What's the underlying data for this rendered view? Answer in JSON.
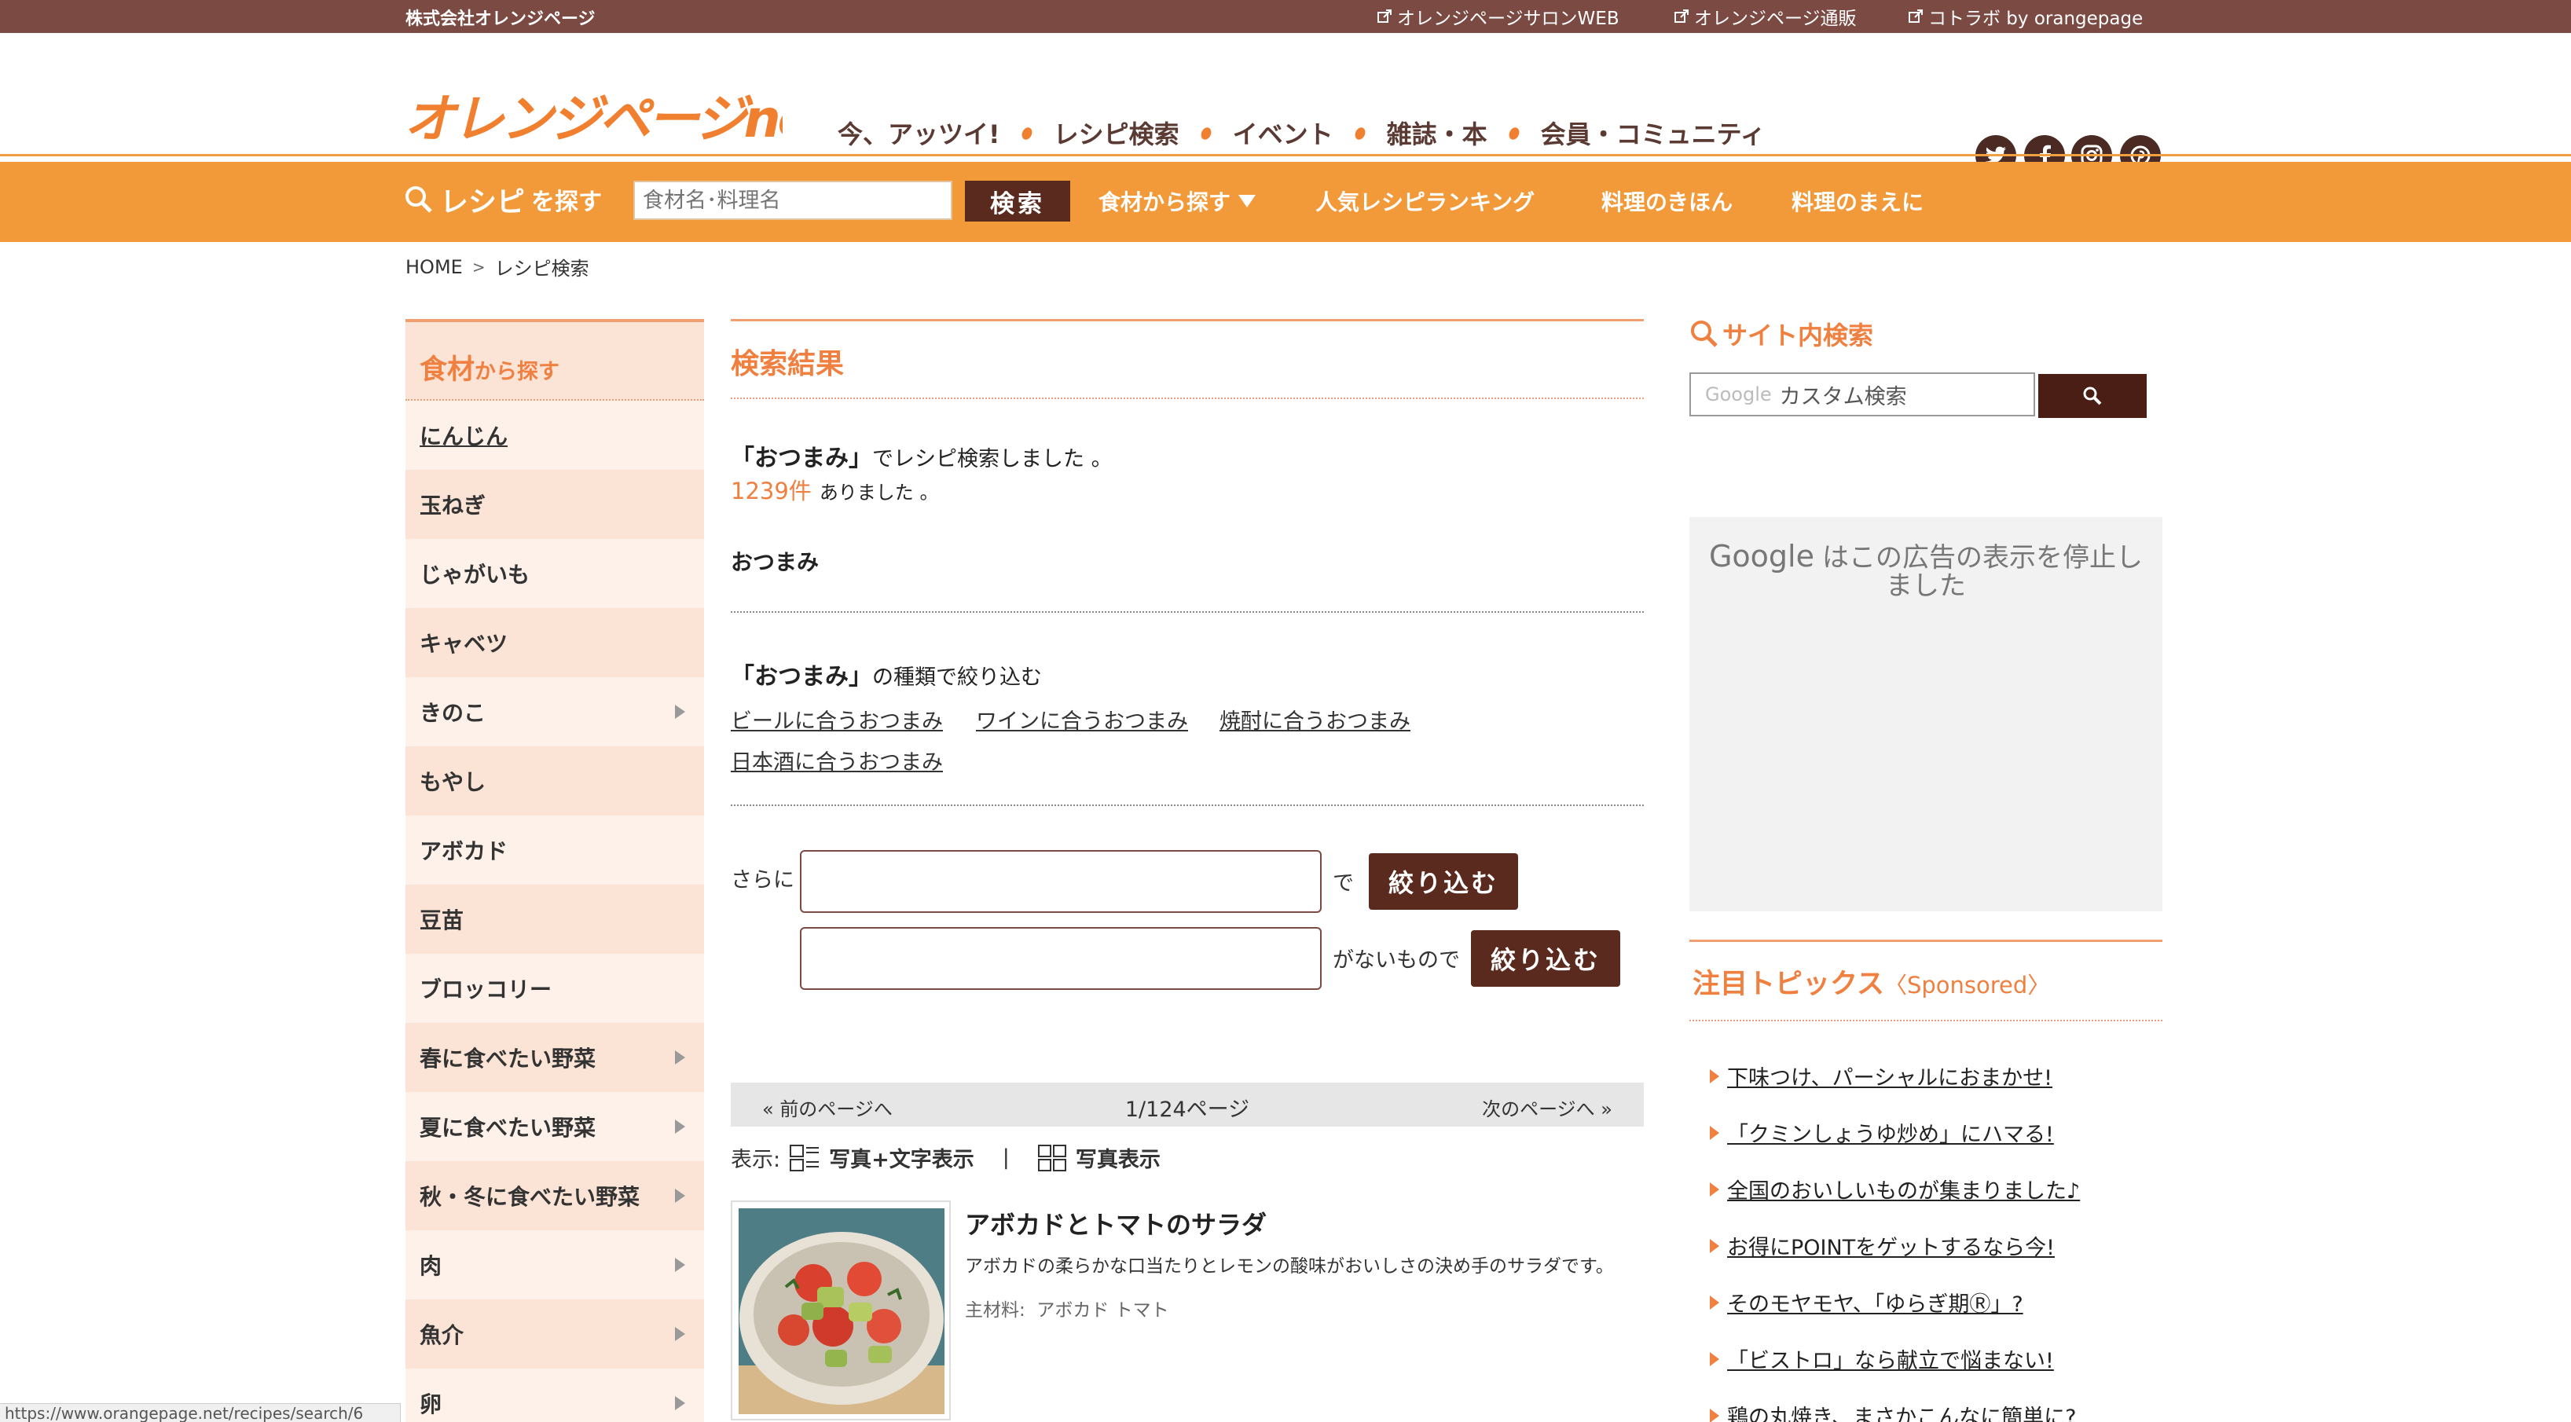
{
  "topbar": {
    "company": "株式会社オレンジページ",
    "links": [
      "オレンジページサロンWEB",
      "オレンジページ通販",
      "コトラボ by orangepage"
    ]
  },
  "header": {
    "logo_text": "オレンジページnet",
    "nav": [
      "今、アッツイ!",
      "レシピ検索",
      "イベント",
      "雑誌・本",
      "会員・コミュニティ"
    ],
    "social": [
      "twitter-icon",
      "facebook-icon",
      "instagram-icon",
      "pinterest-icon"
    ]
  },
  "searchbar": {
    "label_main": "レシピ",
    "label_small": "を探す",
    "placeholder": "食材名･料理名",
    "button": "検索",
    "links": [
      "食材から探す",
      "人気レシピランキング",
      "料理のきほん",
      "料理のまえに"
    ]
  },
  "breadcrumb": {
    "home": "HOME",
    "sep": ">",
    "current": "レシピ検索"
  },
  "sidebar": {
    "head_main": "食材",
    "head_small": "から探す",
    "items": [
      {
        "label": "にんじん",
        "arrow": false,
        "underline": true
      },
      {
        "label": "玉ねぎ",
        "arrow": false
      },
      {
        "label": "じゃがいも",
        "arrow": false
      },
      {
        "label": "キャベツ",
        "arrow": false
      },
      {
        "label": "きのこ",
        "arrow": true
      },
      {
        "label": "もやし",
        "arrow": false
      },
      {
        "label": "アボカド",
        "arrow": false
      },
      {
        "label": "豆苗",
        "arrow": false
      },
      {
        "label": "ブロッコリー",
        "arrow": false
      },
      {
        "label": "春に食べたい野菜",
        "arrow": true
      },
      {
        "label": "夏に食べたい野菜",
        "arrow": true
      },
      {
        "label": "秋・冬に食べたい野菜",
        "arrow": true
      },
      {
        "label": "肉",
        "arrow": true
      },
      {
        "label": "魚介",
        "arrow": true
      },
      {
        "label": "卵",
        "arrow": true
      }
    ]
  },
  "main": {
    "result_title": "検索結果",
    "query_keyword": "「おつまみ」",
    "query_suffix": "でレシピ検索しました 。",
    "count": "1239件",
    "count_suffix": "ありました 。",
    "tag_word": "おつまみ",
    "narrow_keyword": "「おつまみ」",
    "narrow_suffix": "の種類で絞り込む",
    "narrow_links": [
      "ビールに合うおつまみ",
      "ワインに合うおつまみ",
      "焼酎に合うおつまみ",
      "日本酒に合うおつまみ"
    ],
    "filter_prefix": "さらに",
    "filter_with": "で",
    "filter_without": "がないもので",
    "filter_button": "絞り込む",
    "pager_prev": "«  前のページへ",
    "pager_page": "1/124ページ",
    "pager_next": "次のページへ  »",
    "view_label": "表示:",
    "view_list": "写真+文字表示",
    "view_sep": "|",
    "view_grid": "写真表示",
    "recipe": {
      "title": "アボカドとトマトのサラダ",
      "desc": "アボカドの柔らかな口当たりとレモンの酸味がおいしさの決め手のサラダです。",
      "ingredients_label": "主材料:",
      "ingredients": "アボカド トマト"
    }
  },
  "right": {
    "site_search_title": "サイト内検索",
    "google_label": "Google",
    "search_placeholder": "カスタム検索",
    "ad_google": "Google",
    "ad_message": "はこの広告の表示を停止しました",
    "topics_title": "注目トピックス",
    "topics_sponsored": "〈Sponsored〉",
    "topics": [
      "下味つけ、パーシャルにおまかせ!",
      "「クミンしょうゆ炒め」にハマる!",
      "全国のおいしいものが集まりました♪",
      "お得にPOINTをゲットするなら今!",
      "そのモヤモヤ、「ゆらぎ期Ⓡ」?",
      "「ビストロ」なら献立で悩まない!",
      "鶏の丸焼き、まさかこんなに簡単に?"
    ]
  },
  "statusbar": {
    "url": "https://www.orangepage.net/recipes/search/6"
  },
  "colors": {
    "brown": "#7a4a43",
    "orange": "#f29a3a",
    "accent_text": "#f08040",
    "dark_button": "#5a2a1e"
  }
}
